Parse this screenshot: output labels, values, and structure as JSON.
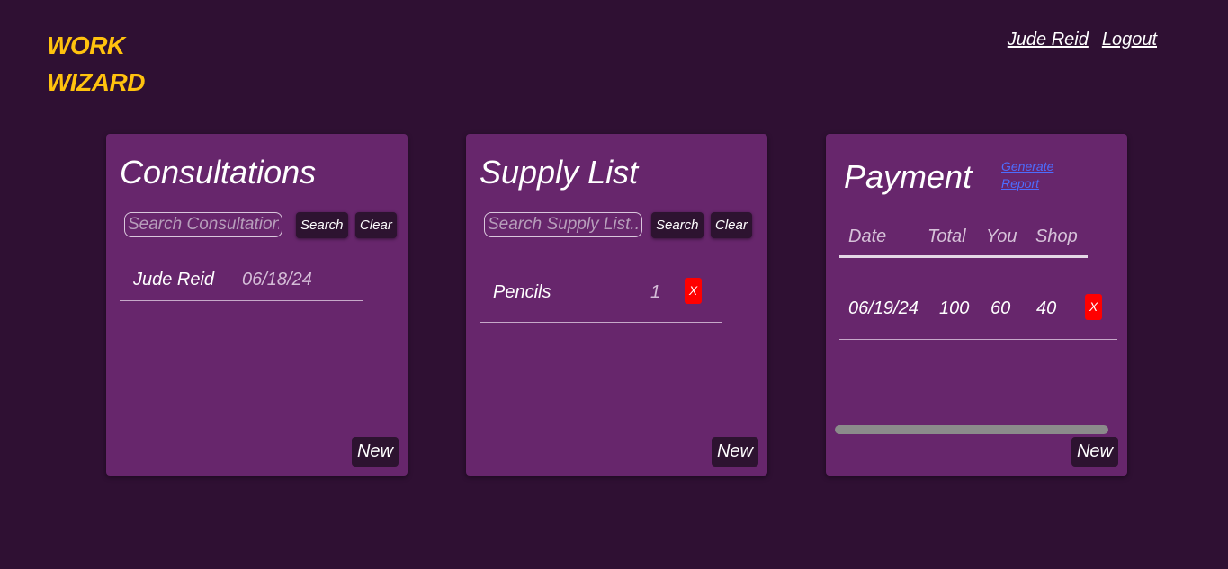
{
  "brand": {
    "line1": "WORK",
    "line2": "WIZARD",
    "color": "#ffc20e"
  },
  "nav": {
    "user": "Jude Reid",
    "logout": "Logout"
  },
  "consultations": {
    "title": "Consultations",
    "search_placeholder": "Search Consultations",
    "search_label": "Search",
    "clear_label": "Clear",
    "rows": [
      {
        "name": "Jude Reid",
        "date": "06/18/24"
      }
    ],
    "new_label": "New"
  },
  "supply": {
    "title": "Supply List",
    "search_placeholder": "Search Supply List...",
    "search_label": "Search",
    "clear_label": "Clear",
    "rows": [
      {
        "item": "Pencils",
        "qty": "1",
        "remove": "X"
      }
    ],
    "new_label": "New"
  },
  "payment": {
    "title": "Payment",
    "report_link": "Generate Report",
    "headers": {
      "date": "Date",
      "total": "Total",
      "you": "You",
      "shop": "Shop"
    },
    "rows": [
      {
        "date": "06/19/24",
        "total": "100",
        "you": "60",
        "shop": "40",
        "remove": "X"
      }
    ],
    "new_label": "New"
  },
  "colors": {
    "background": "#2f1033",
    "card": "#67266c",
    "button": "#2d1330",
    "danger": "#ff0000",
    "link": "#4d6dff"
  }
}
